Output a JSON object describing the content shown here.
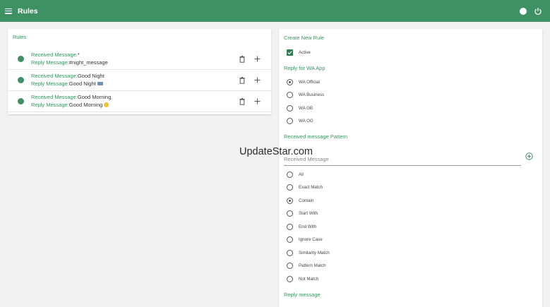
{
  "app": {
    "title": "Rules",
    "menu_icon": "menu-icon",
    "theme_toggle_icon": "toggle-icon",
    "power_icon": "power-icon",
    "accent": "#3d9163"
  },
  "rules_panel": {
    "title": "Rules",
    "received_label": "Received Message:",
    "reply_label": "Reply Message:",
    "items": [
      {
        "received": "*",
        "reply": "#night_message",
        "reply_emoji": ""
      },
      {
        "received": "Good Night",
        "reply": "Good Night",
        "reply_emoji": "bed-emoji"
      },
      {
        "received": "Good Morning",
        "reply": "Good Morning",
        "reply_emoji": "sun-emoji"
      }
    ]
  },
  "create_panel": {
    "title": "Create New Rule",
    "active": {
      "label": "Active",
      "checked": true
    },
    "reply_for": {
      "title": "Reply for WA App",
      "options": [
        "WA Official",
        "WA Business",
        "WA GB",
        "WA OG"
      ],
      "selected": "WA Official"
    },
    "pattern": {
      "title": "Received message Pattern",
      "placeholder": "Received Message",
      "options": [
        "All",
        "Exact Match",
        "Contain",
        "Start With",
        "End With",
        "Ignore Case",
        "Similarity Match",
        "Pattern Match",
        "Not Match"
      ],
      "selected": "Contain"
    },
    "reply_message_title": "Reply message"
  },
  "watermark": "UpdateStar.com"
}
